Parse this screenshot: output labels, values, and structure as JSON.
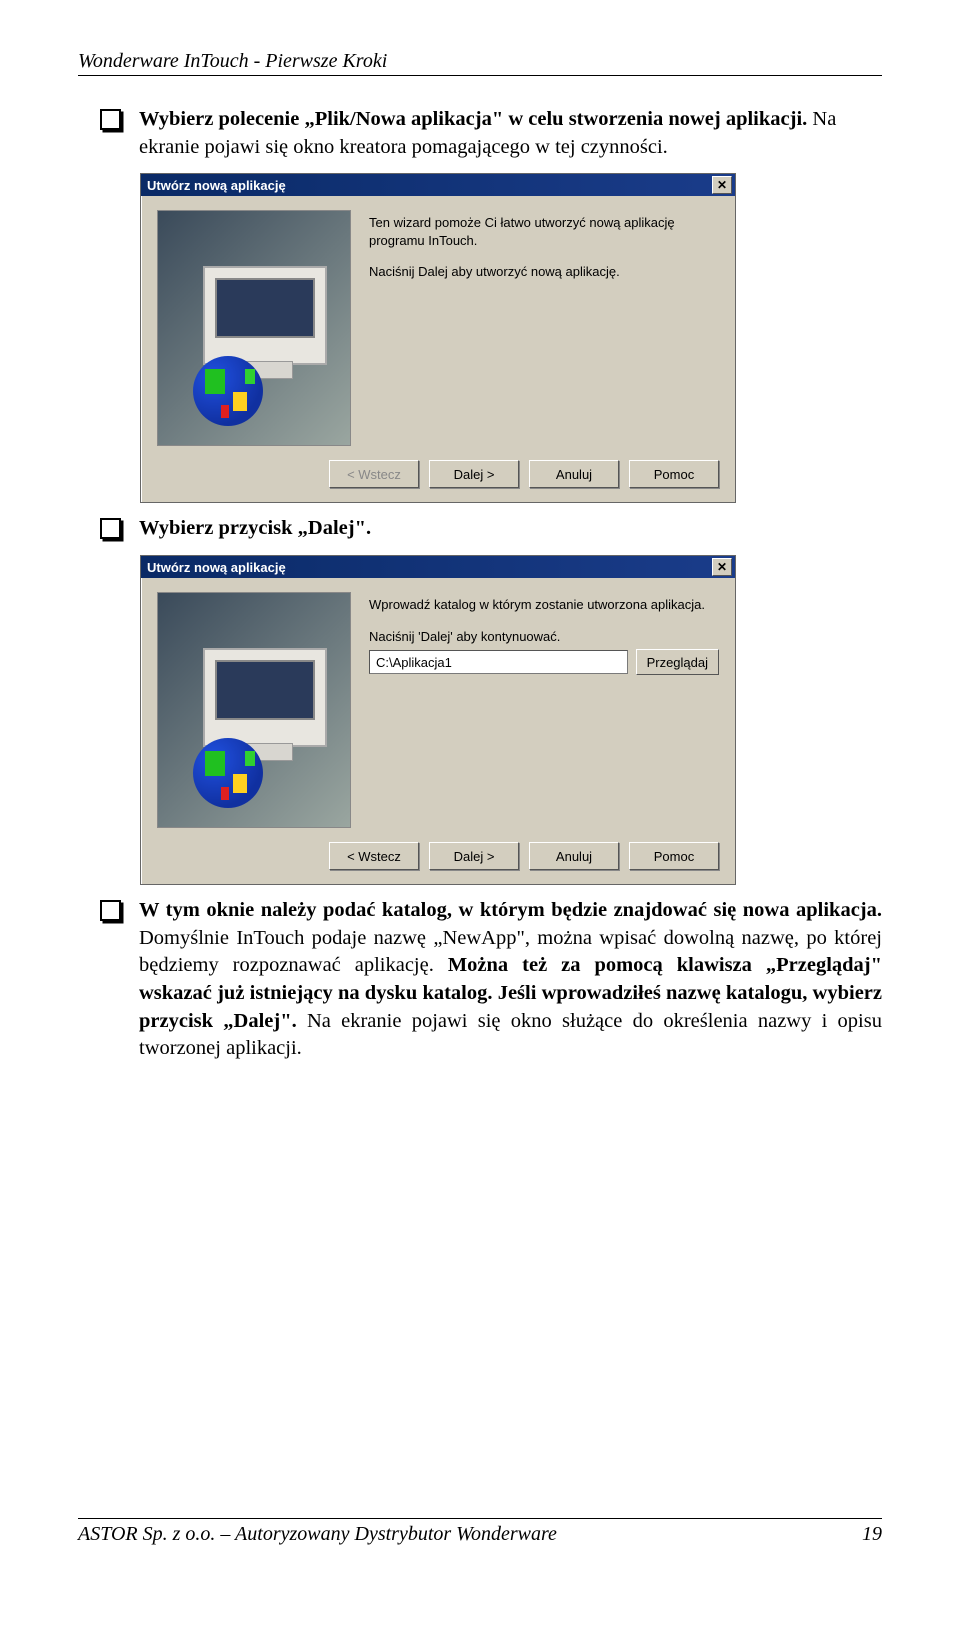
{
  "header": {
    "title": "Wonderware InTouch - Pierwsze Kroki"
  },
  "para1": {
    "p1a": "Wybierz polecenie „Plik/Nowa aplikacja\" w celu stworzenia nowej aplikacji.",
    "p1b": " Na ekranie pojawi się okno kreatora pomagającego w tej czynności."
  },
  "dialog1": {
    "title": "Utwórz nową aplikację",
    "line1": "Ten wizard pomoże Ci łatwo utworzyć nową aplikację programu InTouch.",
    "line2": "Naciśnij Dalej aby utworzyć nową aplikację.",
    "buttons": {
      "back": "< Wstecz",
      "next": "Dalej >",
      "cancel": "Anuluj",
      "help": "Pomoc"
    }
  },
  "para2": {
    "text": "Wybierz przycisk „Dalej\"."
  },
  "dialog2": {
    "title": "Utwórz nową aplikację",
    "line1": "Wprowadź katalog w którym zostanie utworzona aplikacja.",
    "line2": "Naciśnij 'Dalej' aby kontynuować.",
    "path": "C:\\Aplikacja1",
    "browse": "Przeglądaj",
    "buttons": {
      "back": "< Wstecz",
      "next": "Dalej >",
      "cancel": "Anuluj",
      "help": "Pomoc"
    }
  },
  "para3": {
    "t1": "W tym oknie należy podać katalog, w którym będzie znajdować się nowa aplikacja.",
    "t2": " Domyślnie InTouch podaje nazwę „NewApp\", można wpisać dowolną nazwę, po której będziemy rozpoznawać aplikację. ",
    "t3": "Można też za pomocą klawisza „Przeglądaj\" wskazać już istniejący na dysku katalog. Jeśli wprowadziłeś nazwę katalogu, wybierz przycisk „Dalej\".",
    "t4": " Na ekranie pojawi się okno służące do określenia nazwy i opisu tworzonej aplikacji."
  },
  "footer": {
    "left": "ASTOR Sp. z o.o. – Autoryzowany Dystrybutor Wonderware",
    "right": "19"
  }
}
